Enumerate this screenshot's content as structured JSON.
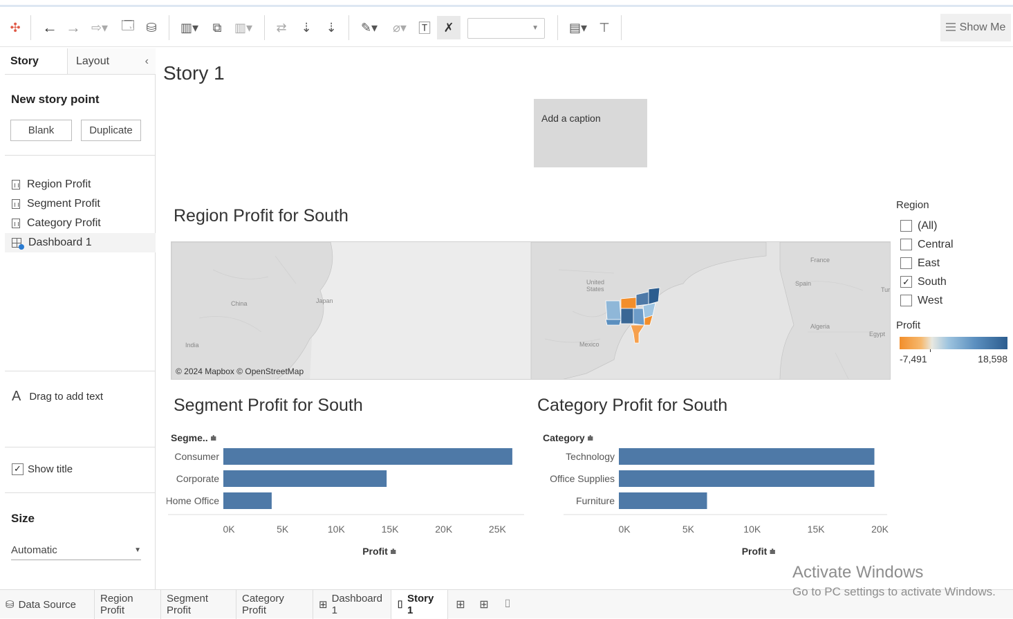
{
  "toolbar": {
    "show_me": "Show Me",
    "icons": [
      "tableau-logo-icon",
      "back-icon",
      "forward-icon",
      "redo-icon",
      "save-icon",
      "new-datasource-icon",
      "new-worksheet-icon",
      "duplicate-icon",
      "clear-icon",
      "swap-icon",
      "sort-asc-icon",
      "sort-desc-icon",
      "highlight-icon",
      "paperclip-icon",
      "text-label-icon",
      "pin-clear-icon",
      "fit-icon",
      "presentation-icon"
    ]
  },
  "left_panel": {
    "tabs": {
      "story": "Story",
      "layout": "Layout"
    },
    "new_story_point": "New story point",
    "blank_button": "Blank",
    "duplicate_button": "Duplicate",
    "sheets": [
      {
        "label": "Region Profit",
        "type": "worksheet"
      },
      {
        "label": "Segment Profit",
        "type": "worksheet"
      },
      {
        "label": "Category Profit",
        "type": "worksheet"
      },
      {
        "label": "Dashboard 1",
        "type": "dashboard"
      }
    ],
    "drag_text": "Drag to add text",
    "show_title": "Show title",
    "show_title_checked": true,
    "size_heading": "Size",
    "size_value": "Automatic"
  },
  "main": {
    "story_title": "Story 1",
    "caption": "Add a caption",
    "region_title": "Region Profit for  South",
    "segment_title": "Segment Profit for South",
    "category_title": "Category Profit for South",
    "map_credit": "© 2024 Mapbox © OpenStreetMap",
    "map_labels": {
      "china": "China",
      "japan": "Japan",
      "india": "India",
      "us": "United States",
      "mexico": "Mexico",
      "france": "France",
      "spain": "Spain",
      "algeria": "Algeria",
      "egypt": "Egypt",
      "turkey": "Turl"
    }
  },
  "legend": {
    "region_title": "Region",
    "regions": [
      {
        "label": "(All)",
        "checked": false
      },
      {
        "label": "Central",
        "checked": false
      },
      {
        "label": "East",
        "checked": false
      },
      {
        "label": "South",
        "checked": true
      },
      {
        "label": "West",
        "checked": false
      }
    ],
    "profit_title": "Profit",
    "profit_min": "-7,491",
    "profit_max": "18,598",
    "colors": {
      "negative": "#f28e2b",
      "positive": "#2c5d8f"
    }
  },
  "chart_data": [
    {
      "type": "bar",
      "title": "Segment Profit for South",
      "category_header": "Segme..",
      "categories": [
        "Consumer",
        "Corporate",
        "Home Office"
      ],
      "values": [
        26900,
        15200,
        4500
      ],
      "xlabel": "Profit",
      "xlim": [
        0,
        28000
      ],
      "ticks": [
        0,
        5000,
        10000,
        15000,
        20000,
        25000
      ],
      "tick_labels": [
        "0K",
        "5K",
        "10K",
        "15K",
        "20K",
        "25K"
      ],
      "color": "#4e79a7"
    },
    {
      "type": "bar",
      "title": "Category Profit for South",
      "category_header": "Category",
      "categories": [
        "Technology",
        "Office Supplies",
        "Furniture"
      ],
      "values": [
        20000,
        20000,
        6900
      ],
      "xlabel": "Profit",
      "xlim": [
        0,
        21000
      ],
      "ticks": [
        0,
        5000,
        10000,
        15000,
        20000
      ],
      "tick_labels": [
        "0K",
        "5K",
        "10K",
        "15K",
        "20K"
      ],
      "color": "#4e79a7"
    }
  ],
  "bottom_tabs": {
    "data_source": "Data Source",
    "region_profit": "Region Profit",
    "segment_profit": "Segment Profit",
    "category_profit": "Category Profit",
    "dashboard": "Dashboard 1",
    "story": "Story 1"
  },
  "watermark": {
    "line1": "Activate Windows",
    "line2": "Go to PC settings to activate Windows."
  }
}
